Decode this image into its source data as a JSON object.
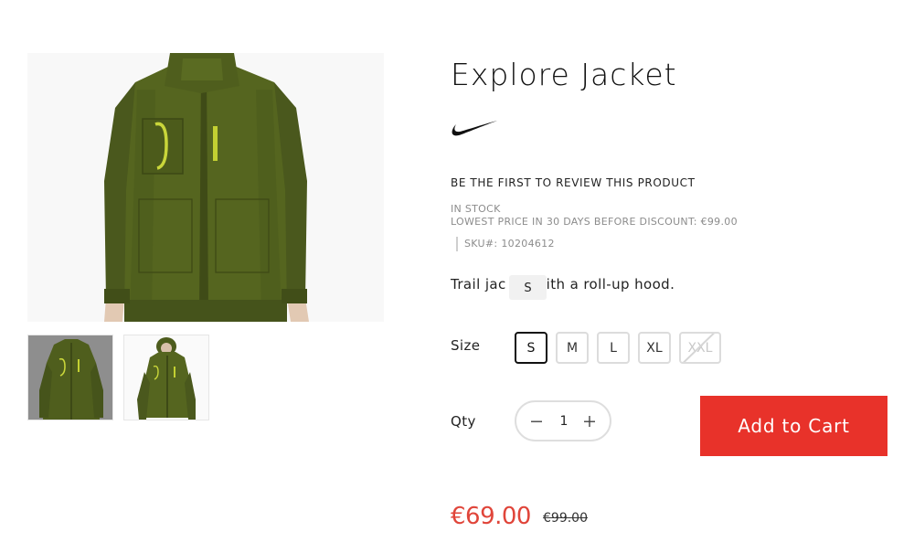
{
  "product": {
    "title": "Explore Jacket",
    "brand_logo_icon": "swoosh-logo-icon",
    "review_link": "BE THE FIRST TO REVIEW THIS PRODUCT",
    "stock_status": "IN STOCK",
    "lowest_price_note": "LOWEST PRICE IN 30 DAYS BEFORE DISCOUNT: €99.00",
    "sku_label": "SKU#:",
    "sku_value": "10204612",
    "description_before": "Trail jac",
    "description_after": "ith a roll-up hood.",
    "tooltip_text": "S"
  },
  "gallery": {
    "main_image_alt": "olive jacket front",
    "thumbnails": [
      "thumbnail-1",
      "thumbnail-2"
    ]
  },
  "options": {
    "size_label": "Size",
    "sizes": [
      "S",
      "M",
      "L",
      "XL",
      "XXL"
    ],
    "selected_size": "S",
    "unavailable_sizes": [
      "XXL"
    ]
  },
  "purchase": {
    "qty_label": "Qty",
    "qty_value": "1",
    "minus_icon": "minus-icon",
    "plus_icon": "plus-icon",
    "add_to_cart_label": "Add to Cart"
  },
  "pricing": {
    "price": "€69.00",
    "old_price": "€99.00",
    "price_color": "#e0453a"
  },
  "colors": {
    "accent": "#e8322a",
    "jacket": "#4b5a1f"
  }
}
